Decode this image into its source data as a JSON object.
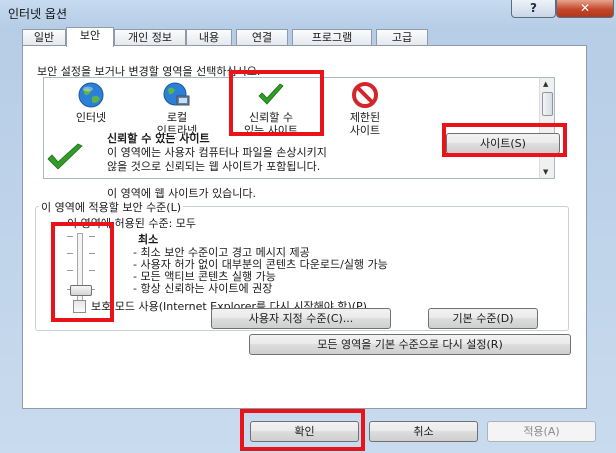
{
  "window": {
    "title": "인터넷 옵션",
    "help_label": "?",
    "close_label": "✕"
  },
  "tabs": [
    {
      "label": "일반"
    },
    {
      "label": "보안",
      "active": true
    },
    {
      "label": "개인 정보"
    },
    {
      "label": "내용"
    },
    {
      "label": "연결"
    },
    {
      "label": "프로그램"
    },
    {
      "label": "고급"
    }
  ],
  "security": {
    "instruction": "보안 설정을 보거나 변경할 영역을 선택하십시오.",
    "zones": [
      {
        "line1": "인터넷",
        "line2": "",
        "icon": "globe-icon"
      },
      {
        "line1": "로컬",
        "line2": "인트라넷",
        "icon": "intranet-globe-icon"
      },
      {
        "line1": "신뢰할 수",
        "line2": "있는 사이트",
        "icon": "checkmark-icon",
        "selected": true
      },
      {
        "line1": "제한된",
        "line2": "사이트",
        "icon": "restricted-icon"
      }
    ],
    "zone_title": "신뢰할 수 있는 사이트",
    "zone_desc_1": "이 영역에는 사용자 컴퓨터나 파일을 손상시키지",
    "zone_desc_2": "않을 것으로 신뢰되는 웹 사이트가 포함됩니다.",
    "sites_note": "이 영역에 웹 사이트가 있습니다.",
    "sites_button": "사이트(S)"
  },
  "level": {
    "group_label": "이 영역에 적용할 보안 수준(L)",
    "allowed_label": "이 영역에 허용된 수준: 모두",
    "title": "최소",
    "bullets": [
      "- 최소 보안 수준이고 경고 메시지 제공",
      "- 사용자 허가 없이 대부분의 콘텐츠 다운로드/실행 가능",
      "- 모든 액티브 콘텐츠 실행 가능",
      "- 항상 신뢰하는 사이트에 권장"
    ],
    "protected_mode_label": "보호 모드 사용(Internet Explorer를 다시 시작해야 함)(P)",
    "protected_mode_checked": false,
    "custom_button": "사용자 지정 수준(C)...",
    "default_button": "기본 수준(D)",
    "reset_all_button": "모든 영역을 기본 수준으로 다시 설정(R)"
  },
  "footer": {
    "ok": "확인",
    "cancel": "취소",
    "apply": "적용(A)"
  },
  "colors": {
    "highlight": "#e8141a",
    "accent_check": "#2f9d27"
  }
}
